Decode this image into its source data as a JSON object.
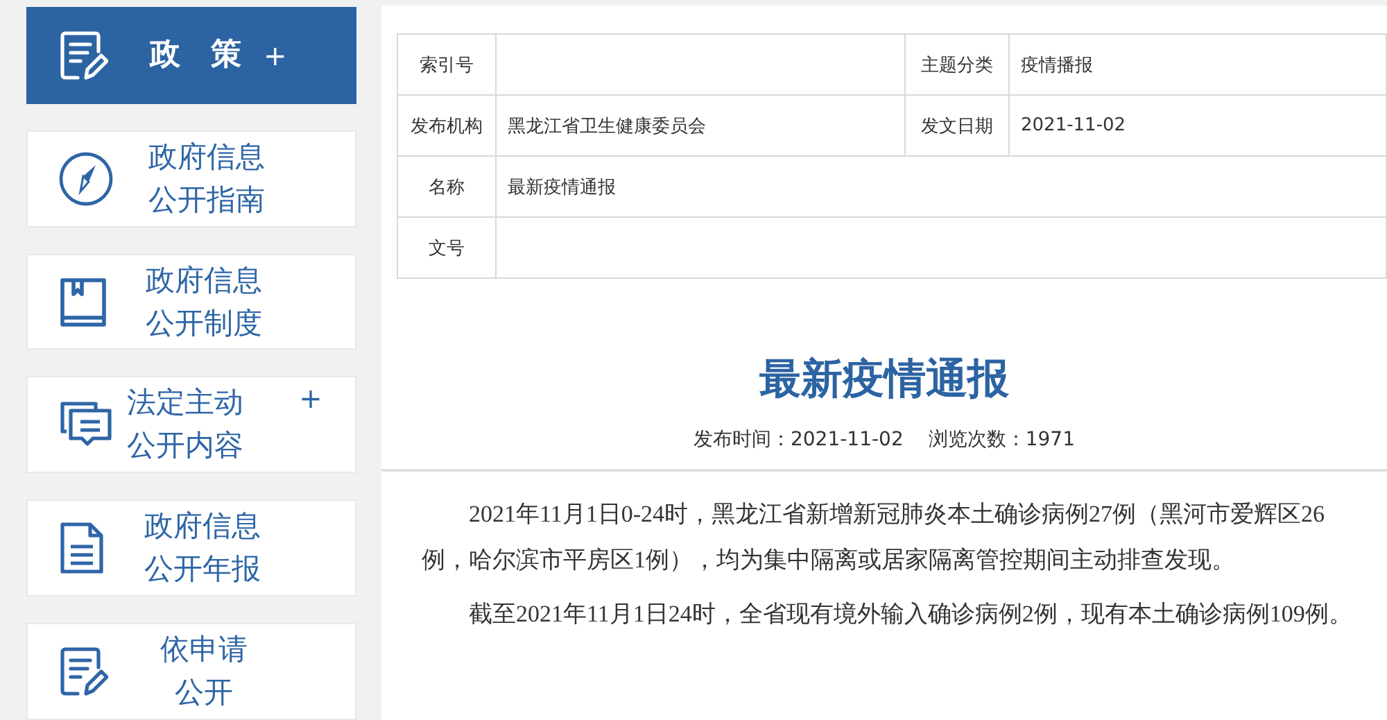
{
  "sidebar": {
    "items": [
      {
        "kind": "note",
        "lines": [
          "政　策"
        ],
        "plus": "+",
        "selected": true
      },
      {
        "kind": "compass",
        "lines": [
          "政府信息",
          "公开指南"
        ],
        "selected": false
      },
      {
        "kind": "book",
        "lines": [
          "政府信息",
          "公开制度"
        ],
        "selected": false
      },
      {
        "kind": "chat",
        "lines": [
          "法定主动",
          "公开内容"
        ],
        "plus": "+",
        "selected": false
      },
      {
        "kind": "doc",
        "lines": [
          "政府信息",
          "公开年报"
        ],
        "selected": false
      },
      {
        "kind": "note",
        "lines": [
          "依申请",
          "公开"
        ],
        "selected": false
      }
    ]
  },
  "info_table": {
    "rows": [
      [
        {
          "label": "索引号"
        },
        {
          "label": "主题分类",
          "value": "疫情播报"
        }
      ],
      [
        {
          "label": "发布机构",
          "value": "黑龙江省卫生健康委员会"
        },
        {
          "label": "发文日期",
          "value": "2021-11-02"
        }
      ],
      [
        {
          "label": "名称",
          "value": "最新疫情通报"
        }
      ],
      [
        {
          "label": "文号"
        }
      ]
    ]
  },
  "article": {
    "title": "最新疫情通报",
    "publish_time": "发布时间：2021-11-02",
    "views": "浏览次数：1971",
    "paragraphs": [
      "2021年11月1日0-24时，黑龙江省新增新冠肺炎本土确诊病例27例（黑河市爱辉区26例，哈尔滨市平房区1例），均为集中隔离或居家隔离管控期间主动排查发现。",
      "截至2021年11月1日24时，全省现有境外输入确诊病例2例，现有本土确诊病例109例。"
    ]
  }
}
